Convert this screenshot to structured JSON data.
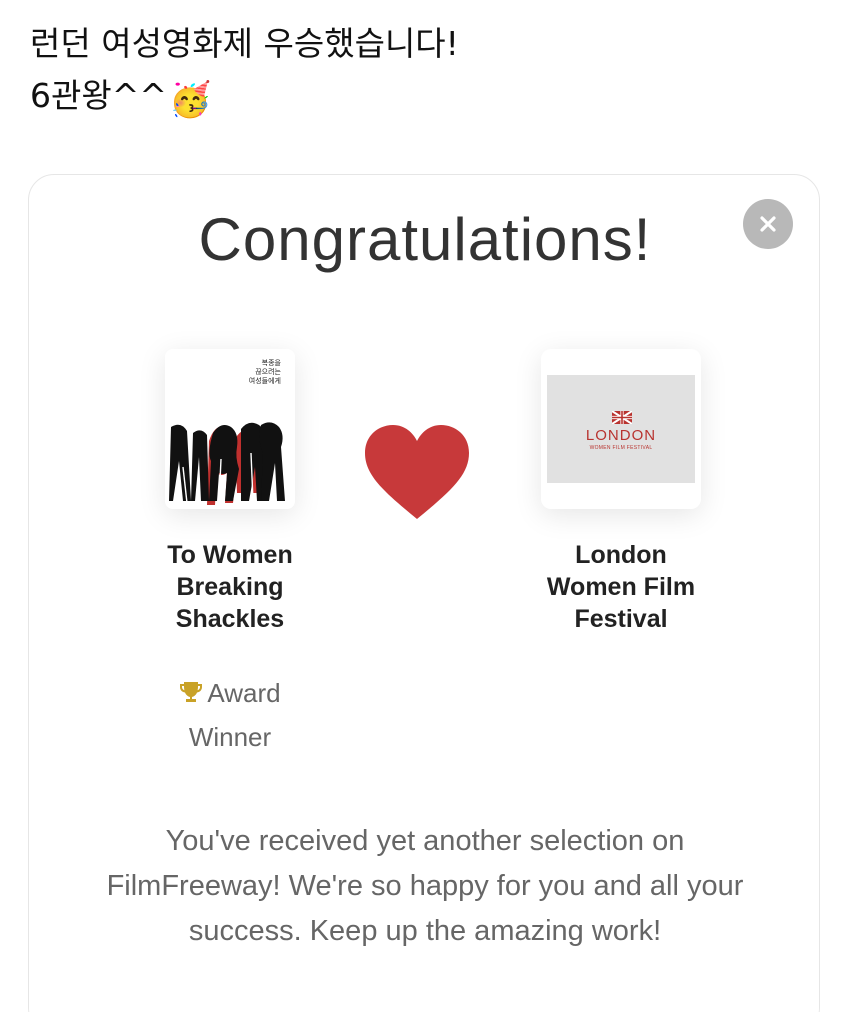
{
  "post": {
    "line1": "런던 여성영화제 우승했습니다!",
    "line2": "6관왕^^",
    "emoji": "🥳"
  },
  "card": {
    "title": "Congratulations!",
    "close_icon": "close-icon",
    "film": {
      "poster_text": [
        "복종을",
        "끊으려는",
        "여성들에게"
      ],
      "title_lines": [
        "To Women",
        "Breaking",
        "Shackles"
      ]
    },
    "festival": {
      "logo_name": "LONDON",
      "logo_sub": "WOMEN FILM FESTIVAL",
      "title_lines": [
        "London",
        "Women Film",
        "Festival"
      ]
    },
    "award": {
      "line1": "Award",
      "line2": "Winner",
      "icon": "trophy-icon"
    },
    "message": "You've received yet another selection on FilmFreeway! We're so happy for you and all your success. Keep up the amazing work!"
  },
  "colors": {
    "heart": "#c7393a",
    "trophy": "#c9a227",
    "logo_text": "#b8332f",
    "close_bg": "#b8b8b8"
  }
}
